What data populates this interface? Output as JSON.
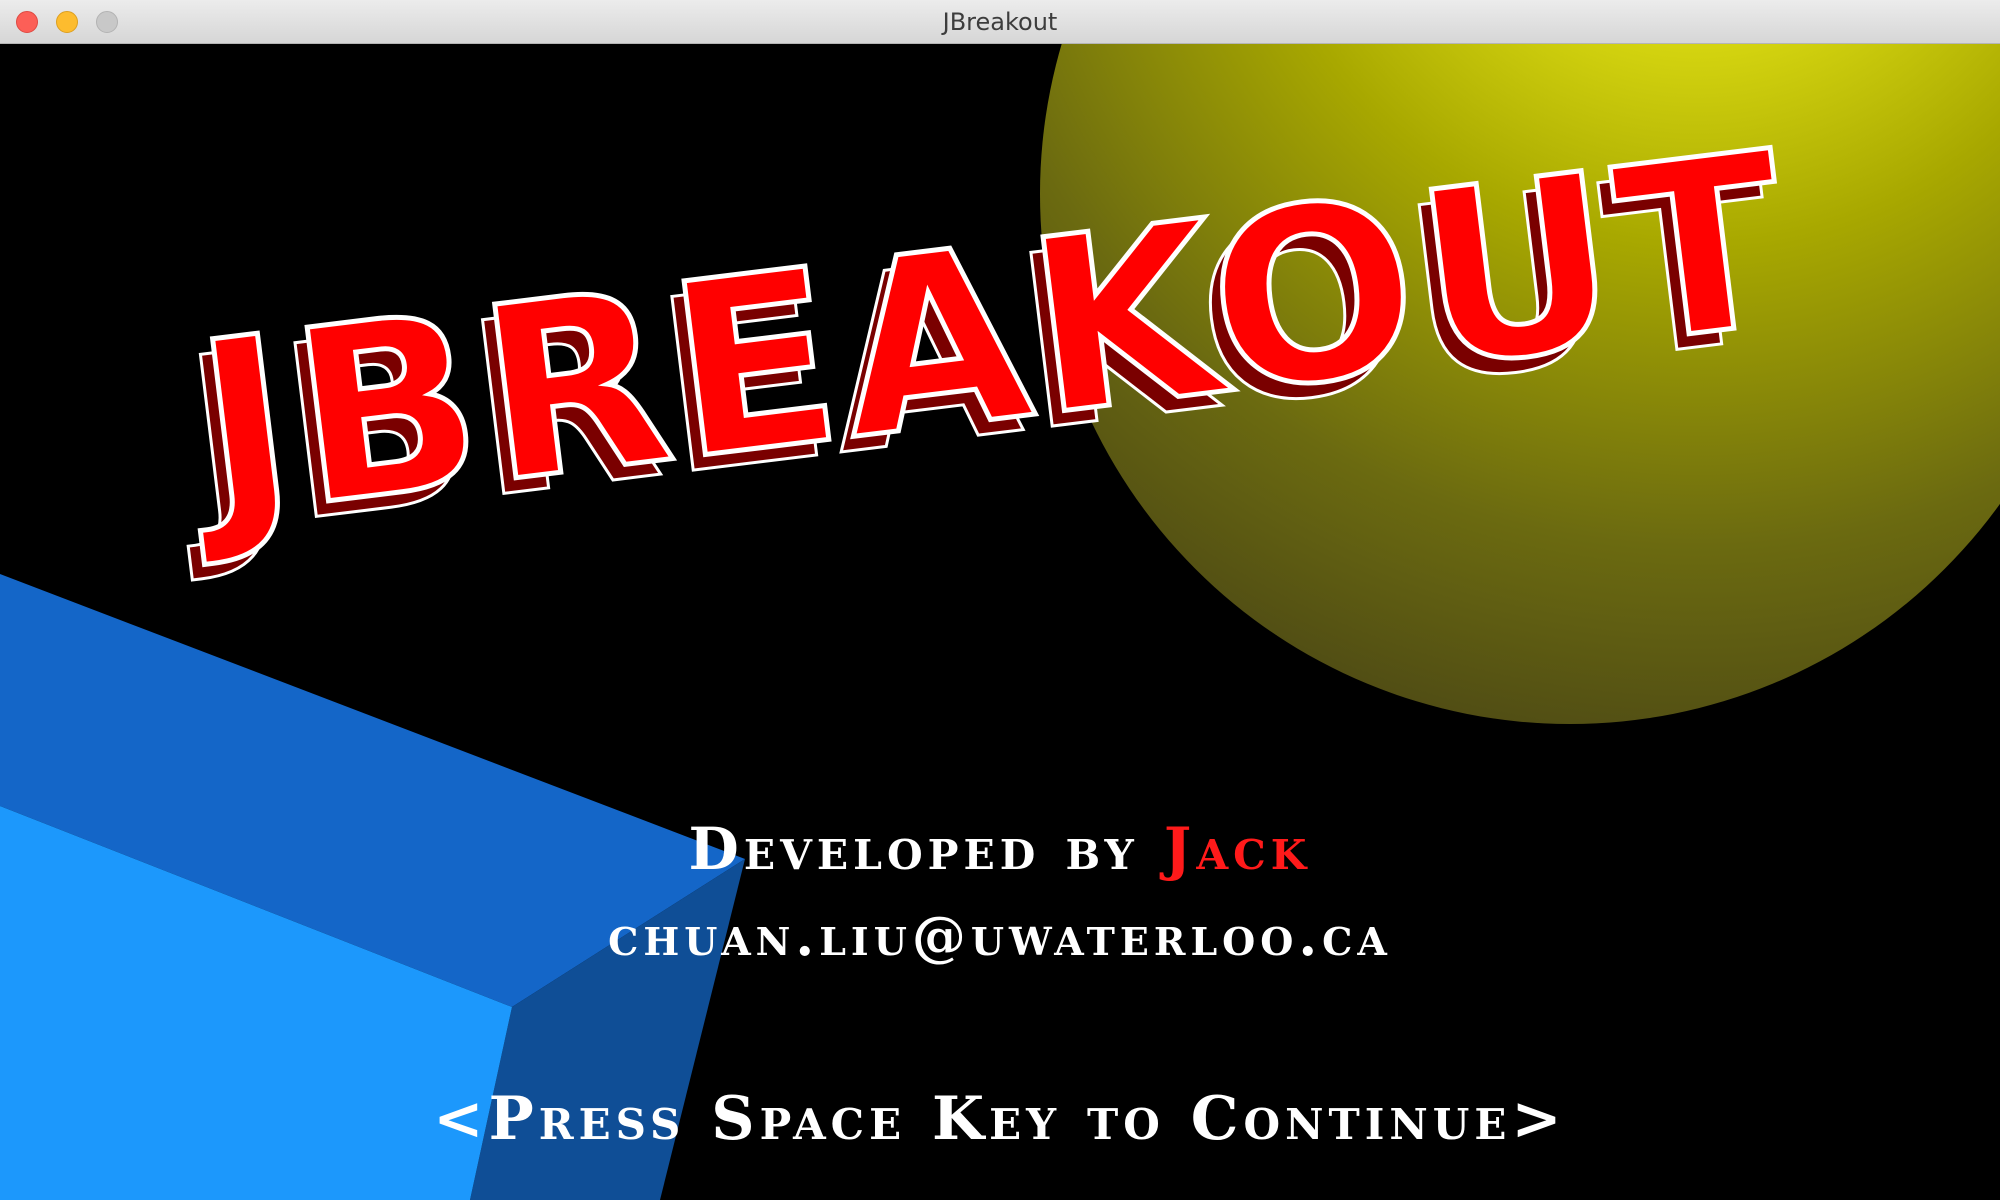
{
  "window": {
    "title": "JBreakout"
  },
  "title_screen": {
    "logo": "JBREAKOUT",
    "credit_prefix": "Developed by",
    "credit_name": "Jack",
    "email": "chuan.liu@uwaterloo.ca",
    "prompt": "<Press Space Key to Continue>"
  },
  "colors": {
    "background": "#000000",
    "logo_face": "#ff0000",
    "logo_outline": "#ffffff",
    "ball": "#e6e600",
    "cube_front": "#1e96ff",
    "cube_top": "#1464c8",
    "accent_name": "#ff1a1a"
  },
  "icons": [
    "close-icon",
    "minimize-icon",
    "maximize-icon"
  ]
}
